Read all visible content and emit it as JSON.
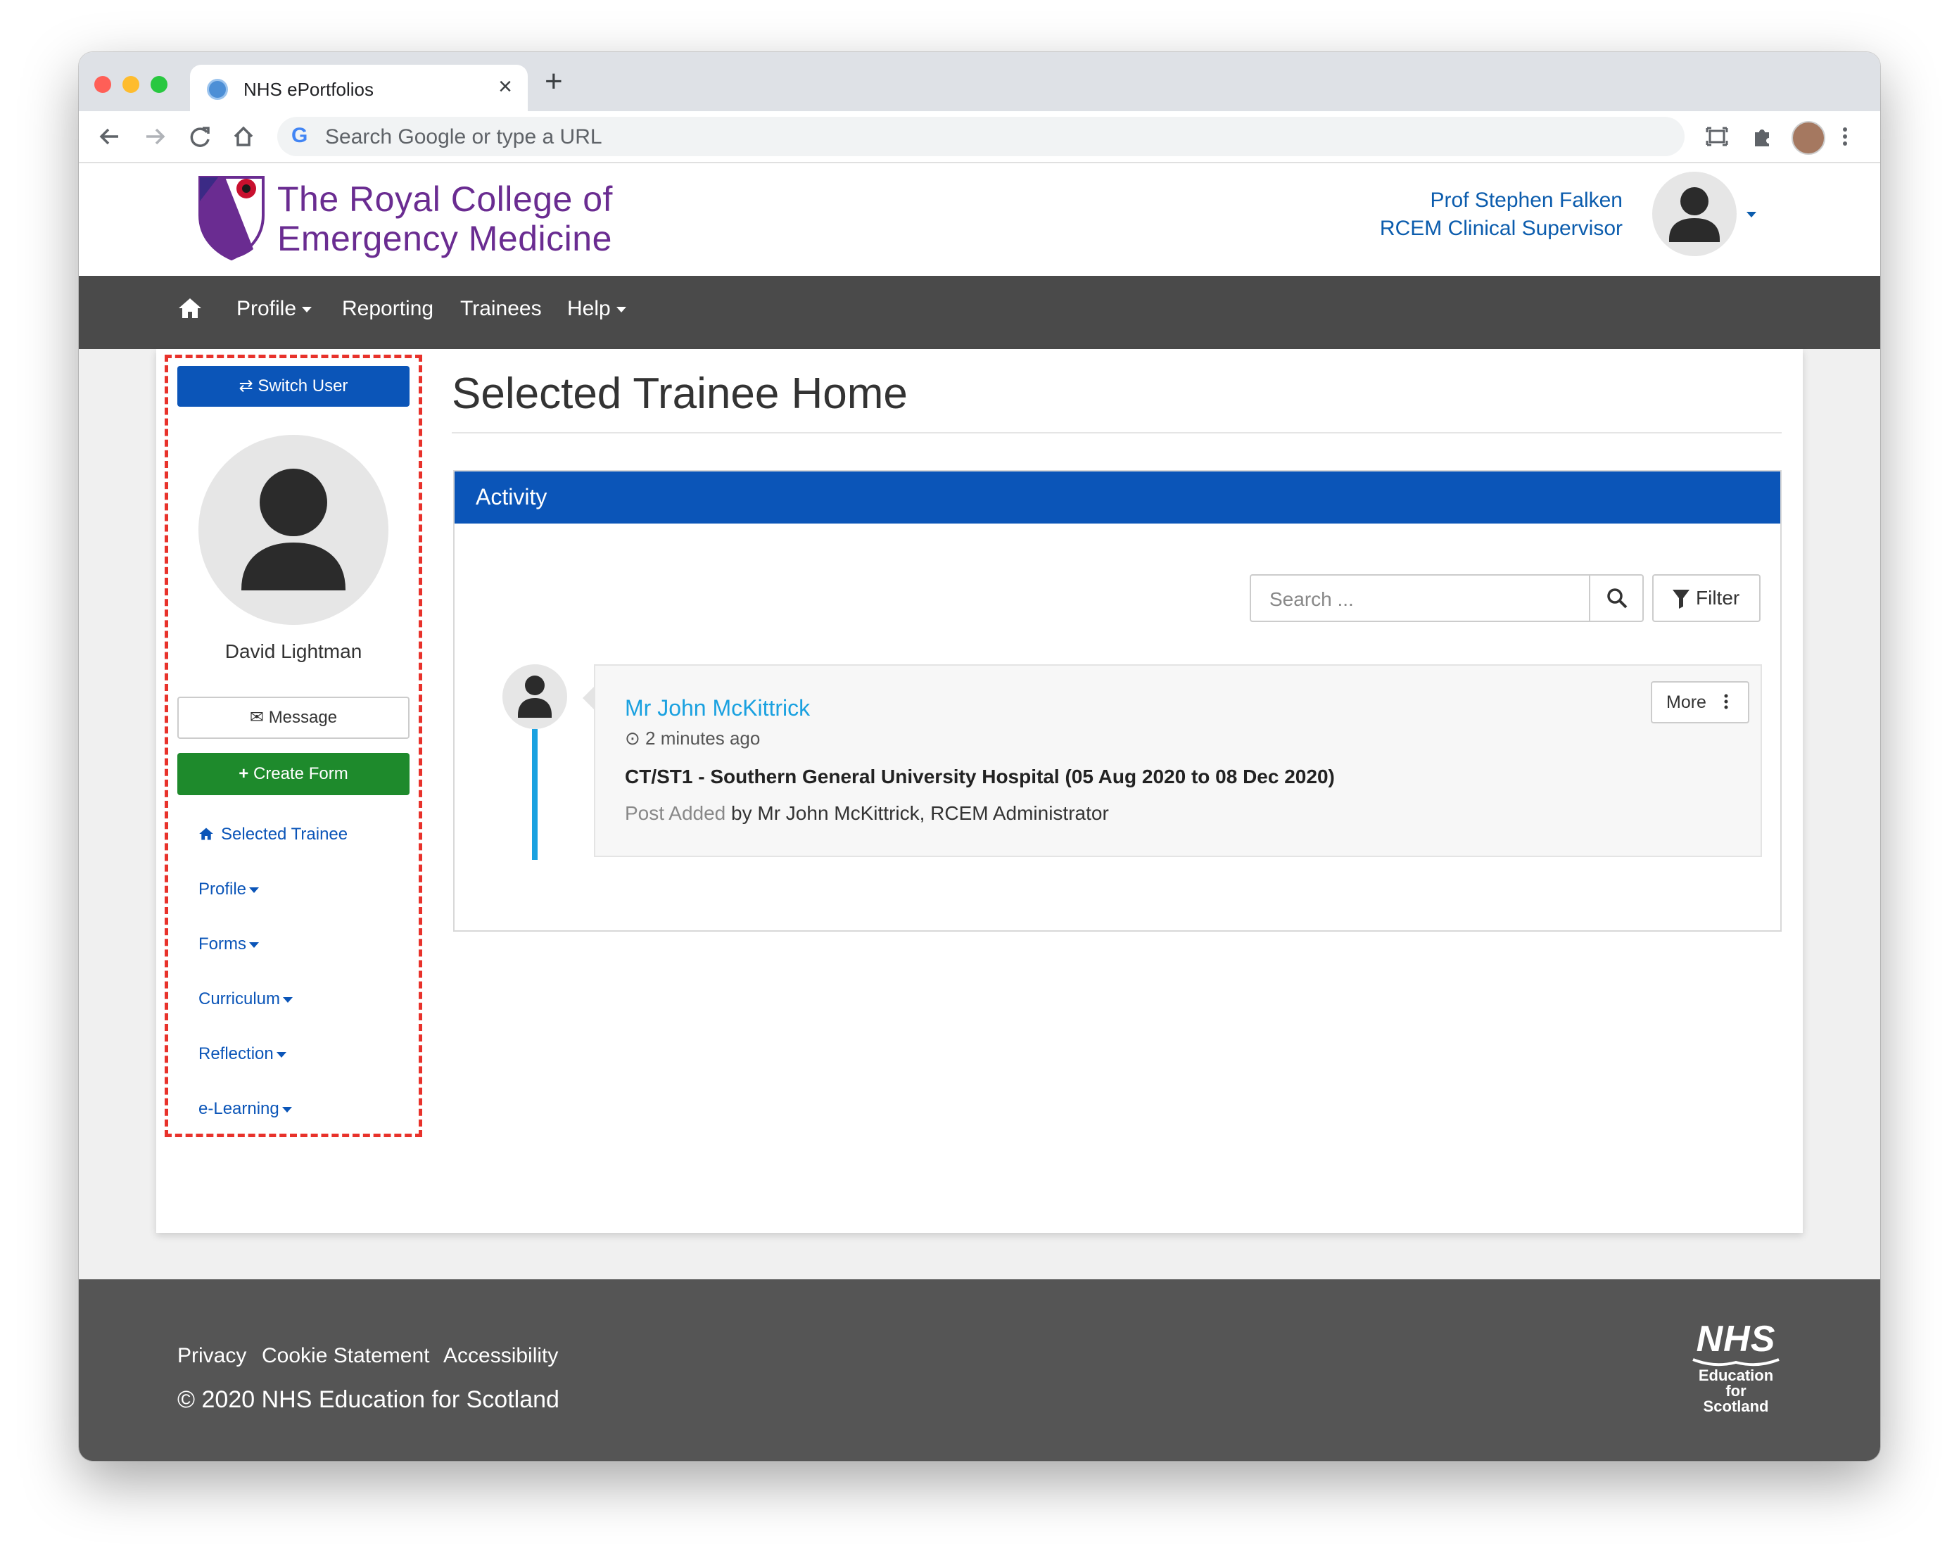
{
  "browser": {
    "tab_title": "NHS ePortfolios",
    "tab_close": "×",
    "new_tab": "+",
    "omnibox_placeholder": "Search Google or type a URL",
    "omnibox_g": "G",
    "icons": [
      "back-icon",
      "forward-icon",
      "reload-icon",
      "home-icon",
      "screenshot-icon",
      "extensions-icon",
      "profile-avatar",
      "menu-icon"
    ]
  },
  "header": {
    "logo_line1": "The Royal College of",
    "logo_line2": "Emergency Medicine",
    "user_name": "Prof Stephen Falken",
    "user_role": "RCEM Clinical Supervisor"
  },
  "nav": {
    "items": [
      {
        "label": "Profile",
        "dropdown": true
      },
      {
        "label": "Reporting",
        "dropdown": false
      },
      {
        "label": "Trainees",
        "dropdown": false
      },
      {
        "label": "Help",
        "dropdown": true
      }
    ]
  },
  "sidebar": {
    "switch_user": "Switch User",
    "trainee_name": "David Lightman",
    "message": "Message",
    "create_form": "Create Form",
    "links": [
      {
        "label": "Selected Trainee",
        "icon": "home-icon"
      },
      {
        "label": "Profile",
        "dropdown": true
      },
      {
        "label": "Forms",
        "dropdown": true
      },
      {
        "label": "Curriculum",
        "dropdown": true
      },
      {
        "label": "Reflection",
        "dropdown": true
      },
      {
        "label": "e-Learning",
        "dropdown": true
      }
    ]
  },
  "main": {
    "page_title": "Selected Trainee Home",
    "panel_title": "Activity",
    "search_placeholder": "Search ...",
    "filter_label": "Filter",
    "activity": {
      "name": "Mr John McKittrick",
      "time": "2 minutes ago",
      "post": "CT/ST1 - Southern General University Hospital (05 Aug 2020 to 08 Dec 2020)",
      "action": "Post Added",
      "by": " by Mr John McKittrick, RCEM Administrator",
      "more_label": "More"
    }
  },
  "footer": {
    "links": [
      "Privacy",
      "Cookie Statement",
      "Accessibility"
    ],
    "copyright": "© 2020 NHS Education for Scotland",
    "logo_nhs": "NHS",
    "logo_line1": "Education",
    "logo_line2": "for",
    "logo_line3": "Scotland"
  },
  "colors": {
    "brand_purple": "#6a2c91",
    "primary_blue": "#0b55b8",
    "success_green": "#1e8a2c",
    "link_cyan": "#1aa1e0",
    "nav_dark": "#4a4a4a",
    "footer_gray": "#555555",
    "highlight_red": "#e8322b"
  }
}
